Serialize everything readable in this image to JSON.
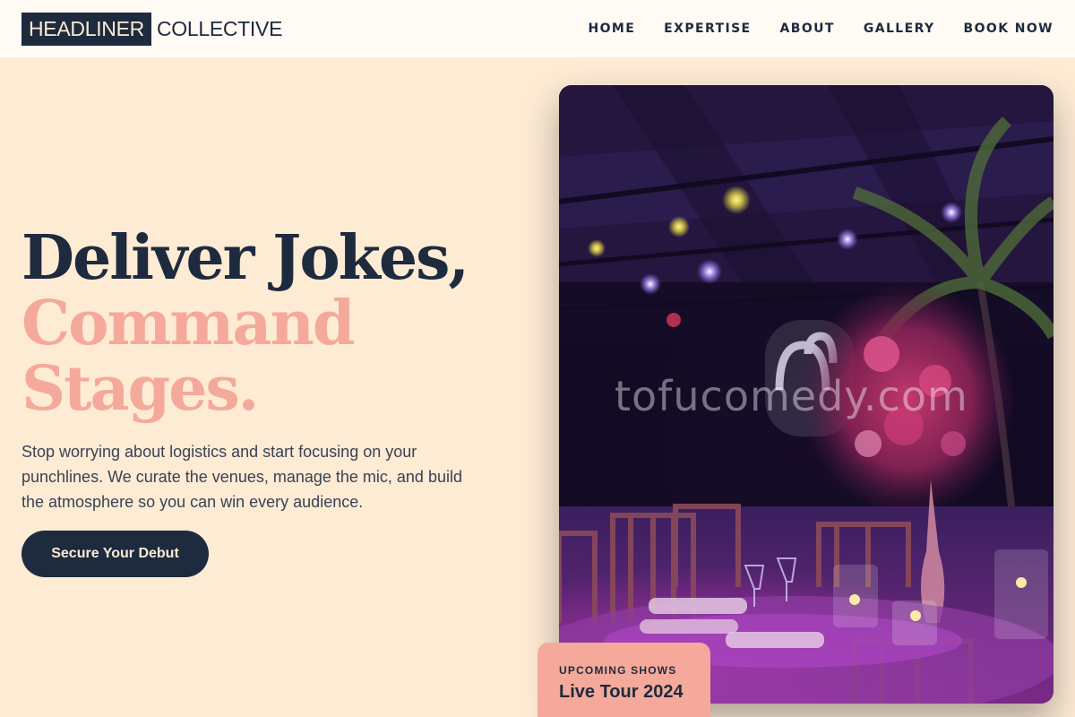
{
  "brand": {
    "box": "HEADLINER",
    "rest": "COLLECTIVE"
  },
  "nav": [
    {
      "label": "HOME"
    },
    {
      "label": "EXPERTISE"
    },
    {
      "label": "ABOUT"
    },
    {
      "label": "GALLERY"
    },
    {
      "label": "BOOK NOW"
    }
  ],
  "hero": {
    "line1": "Deliver Jokes,",
    "line2": "Command",
    "line3": "Stages.",
    "subtitle": "Stop worrying about logistics and start focusing on your punchlines. We curate the venues, manage the mic, and build the atmosphere so you can win every audience.",
    "cta": "Secure Your Debut"
  },
  "photo": {
    "watermark": "tofucomedy.com"
  },
  "badge": {
    "kicker": "UPCOMING SHOWS",
    "title": "Live Tour 2024"
  },
  "colors": {
    "navy": "#1e2a3e",
    "cream": "#fdebd3",
    "salmon": "#f4a99a"
  }
}
